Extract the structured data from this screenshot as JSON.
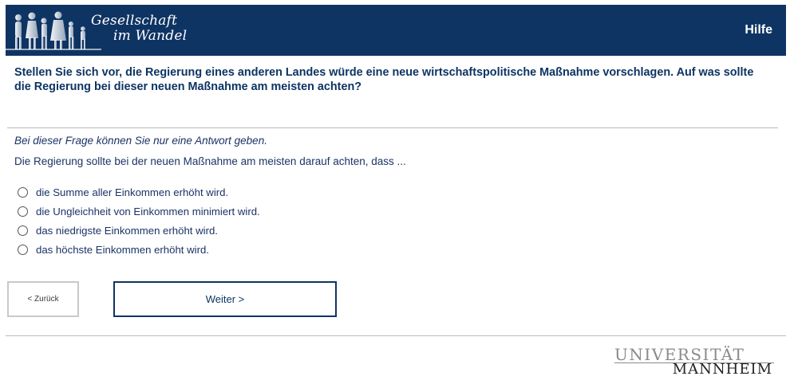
{
  "header": {
    "logo_line1": "Gesellschaft",
    "logo_line2": "im Wandel",
    "help_label": "Hilfe",
    "background": "#0e3463"
  },
  "question": {
    "text": "Stellen Sie sich vor, die Regierung eines anderen Landes würde eine neue wirtschaftspolitische Maßnahme vorschlagen. Auf was sollte die Regierung bei dieser neuen Maßnahme am meisten achten?",
    "instruction": "Bei dieser Frage können Sie nur eine Antwort geben.",
    "stem": "Die Regierung sollte bei der neuen Maßnahme am meisten darauf achten, dass ..."
  },
  "options": [
    {
      "label": "die Summe aller Einkommen erhöht wird.",
      "selected": false
    },
    {
      "label": "die Ungleichheit von Einkommen minimiert wird.",
      "selected": false
    },
    {
      "label": "das niedrigste Einkommen erhöht wird.",
      "selected": false
    },
    {
      "label": "das höchste Einkommen erhöht wird.",
      "selected": false
    }
  ],
  "navigation": {
    "back_label": "< Zurück",
    "next_label": "Weiter >"
  },
  "footer": {
    "university_line1": "UNIVERSITÄT",
    "university_line2": "MANNHEIM"
  }
}
